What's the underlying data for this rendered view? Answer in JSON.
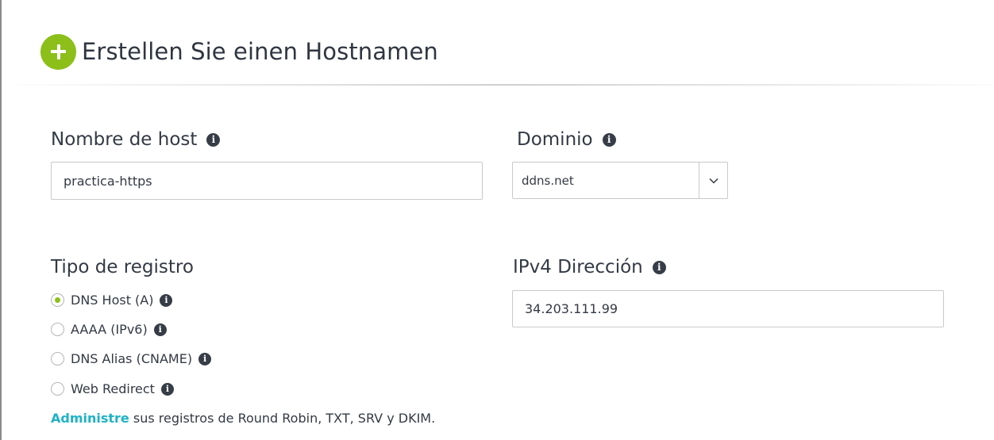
{
  "header": {
    "title": "Erstellen Sie einen Hostnamen",
    "icon": "plus-circle-icon",
    "accent_color": "#8cbf1a"
  },
  "hostname": {
    "label": "Nombre de host",
    "value": "practica-https"
  },
  "domain": {
    "label": "Dominio",
    "selected": "ddns.net"
  },
  "record_type": {
    "label": "Tipo de registro",
    "options": [
      {
        "label": "DNS Host (A)",
        "checked": true
      },
      {
        "label": "AAAA (IPv6)",
        "checked": false
      },
      {
        "label": "DNS Alias (CNAME)",
        "checked": false
      },
      {
        "label": "Web Redirect",
        "checked": false
      }
    ]
  },
  "ipv4": {
    "label": "IPv4 Dirección",
    "value": "34.203.111.99"
  },
  "footnote": {
    "link": "Administre",
    "text": " sus registros de Round Robin, TXT, SRV y DKIM.",
    "link_color": "#1fb2c6"
  },
  "info_icon_glyph": "i"
}
